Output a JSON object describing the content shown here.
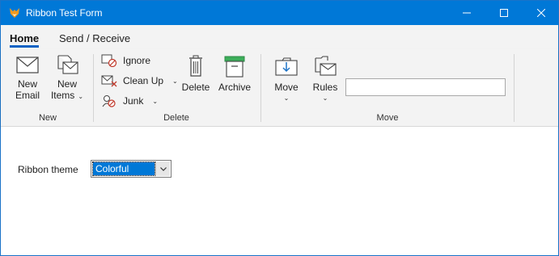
{
  "window": {
    "title": "Ribbon Test Form",
    "icon": "app-fox-icon",
    "controls": [
      "minimize-icon",
      "maximize-icon",
      "close-icon"
    ]
  },
  "tabs": [
    {
      "label": "Home",
      "selected": true
    },
    {
      "label": "Send / Receive",
      "selected": false
    }
  ],
  "ribbon": {
    "groups": {
      "new": {
        "label": "New",
        "buttons": [
          {
            "line1": "New",
            "line2": "Email",
            "icon": "envelope-icon"
          },
          {
            "line1": "New",
            "line2": "Items",
            "icon": "new-items-icon",
            "dropdown": true
          }
        ]
      },
      "delete": {
        "label": "Delete",
        "small_buttons": [
          {
            "label": "Ignore",
            "icon": "ignore-icon"
          },
          {
            "label": "Clean Up",
            "icon": "clean-up-icon",
            "dropdown": true
          },
          {
            "label": "Junk",
            "icon": "junk-icon",
            "dropdown": true
          }
        ],
        "buttons": [
          {
            "label": "Delete",
            "icon": "trash-icon"
          },
          {
            "label": "Archive",
            "icon": "archive-icon"
          }
        ]
      },
      "move": {
        "label": "Move",
        "buttons": [
          {
            "label": "Move",
            "icon": "move-folder-icon",
            "dropdown": true
          },
          {
            "label": "Rules",
            "icon": "rules-icon",
            "dropdown": true
          }
        ],
        "search_value": ""
      }
    }
  },
  "form": {
    "theme_label": "Ribbon theme",
    "theme_value": "Colorful"
  },
  "colors": {
    "titlebar": "#0078d7",
    "accent": "#0b62c4",
    "ribbon_bg": "#f3f3f3"
  }
}
